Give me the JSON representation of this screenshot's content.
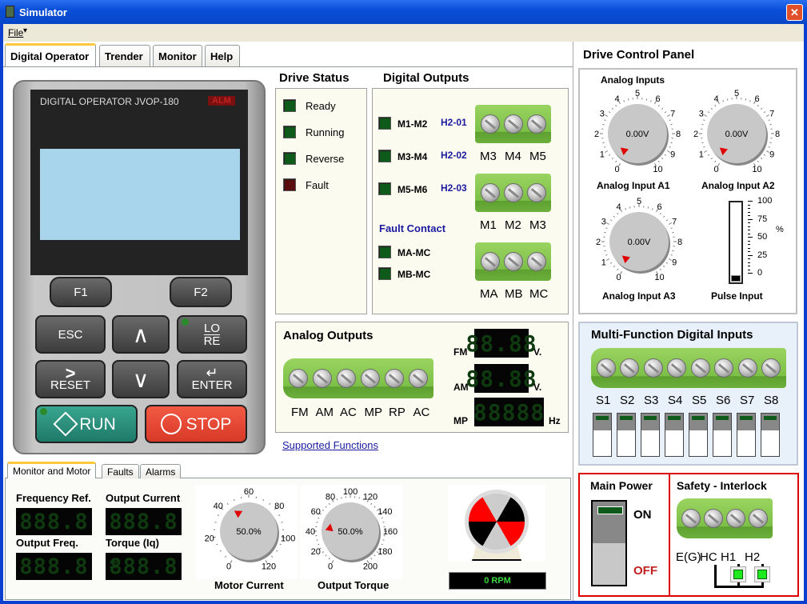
{
  "window": {
    "title": "Simulator",
    "close": "✕"
  },
  "menu": {
    "file": "File",
    "arrow": "▾"
  },
  "tabs": [
    "Digital Operator",
    "Trender",
    "Monitor",
    "Help"
  ],
  "operator": {
    "brand": "DIGITAL OPERATOR JVOP-180",
    "alm": "ALM",
    "f1": "F1",
    "f2": "F2",
    "esc": "ESC",
    "up": "∧",
    "lo": "LO",
    "re": "RE",
    "reset_arrow": ">",
    "reset": "RESET",
    "down": "∨",
    "enter_arrow": "↵",
    "enter": "ENTER",
    "run": "RUN",
    "stop": "STOP",
    "lcd_color": "#a8d4ec"
  },
  "drive_status": {
    "title": "Drive Status",
    "items": [
      {
        "label": "Ready",
        "color": "#0d5a1a"
      },
      {
        "label": "Running",
        "color": "#0d5a1a"
      },
      {
        "label": "Reverse",
        "color": "#0d5a1a"
      },
      {
        "label": "Fault",
        "color": "#5a0d0d"
      }
    ]
  },
  "digital_outputs": {
    "title": "Digital Outputs",
    "rows": [
      {
        "label": "M1-M2",
        "param": "H2-01"
      },
      {
        "label": "M3-M4",
        "param": "H2-02"
      },
      {
        "label": "M5-M6",
        "param": "H2-03"
      }
    ],
    "fault_title": "Fault Contact",
    "fault_rows": [
      "MA-MC",
      "MB-MC"
    ],
    "blocks": [
      [
        "M3",
        "M4",
        "M5"
      ],
      [
        "M1",
        "M2",
        "M3"
      ],
      [
        "MA",
        "MB",
        "MC"
      ]
    ]
  },
  "analog_outputs": {
    "title": "Analog Outputs",
    "terminals": [
      "FM",
      "AM",
      "AC",
      "MP",
      "RP",
      "AC"
    ],
    "meters": [
      {
        "label": "FM",
        "display": "88.88",
        "unit": "V."
      },
      {
        "label": "AM",
        "display": "88.88",
        "unit": "V."
      },
      {
        "label": "MP",
        "display": "88888",
        "unit": "Hz"
      }
    ]
  },
  "link": "Supported Functions",
  "bottom": {
    "tabs": [
      "Monitor and Motor",
      "Faults",
      "Alarms"
    ],
    "monitors": [
      {
        "label": "Frequency Ref.",
        "display": "888.8"
      },
      {
        "label": "Output Current",
        "display": "888.8"
      },
      {
        "label": "Output Freq.",
        "display": "888.8"
      },
      {
        "label": "Torque (Iq)",
        "display": "888.8",
        "sign": "±"
      }
    ],
    "gauges": [
      {
        "name": "Motor Current",
        "value": "50.0%",
        "ticks": [
          "0",
          "20",
          "40",
          "60",
          "80",
          "100",
          "120"
        ]
      },
      {
        "name": "Output Torque",
        "value": "50.0%",
        "ticks": [
          "0",
          "20",
          "40",
          "60",
          "80",
          "100",
          "120",
          "140",
          "160",
          "180",
          "200"
        ]
      }
    ],
    "rpm": "0 RPM"
  },
  "right": {
    "title": "Drive Control Panel",
    "analog_title": "Analog Inputs",
    "knobs": [
      {
        "name": "Analog Input A1",
        "value": "0.00V"
      },
      {
        "name": "Analog Input A2",
        "value": "0.00V"
      },
      {
        "name": "Analog Input A3",
        "value": "0.00V"
      }
    ],
    "knob_ticks": [
      "0",
      "1",
      "2",
      "3",
      "4",
      "5",
      "6",
      "7",
      "8",
      "9",
      "10"
    ],
    "pulse": {
      "name": "Pulse Input",
      "unit": "%",
      "ticks": [
        "100",
        "75",
        "50",
        "25",
        "0"
      ],
      "value": 0
    },
    "mfdi_title": "Multi-Function Digital Inputs",
    "inputs": [
      "S1",
      "S2",
      "S3",
      "S4",
      "S5",
      "S6",
      "S7",
      "S8"
    ],
    "power": {
      "title": "Main Power",
      "on": "ON",
      "off": "OFF",
      "state": "ON"
    },
    "safety": {
      "title": "Safety - Interlock",
      "labels": [
        "E(G)",
        "HC",
        "H1",
        "H2"
      ]
    }
  }
}
